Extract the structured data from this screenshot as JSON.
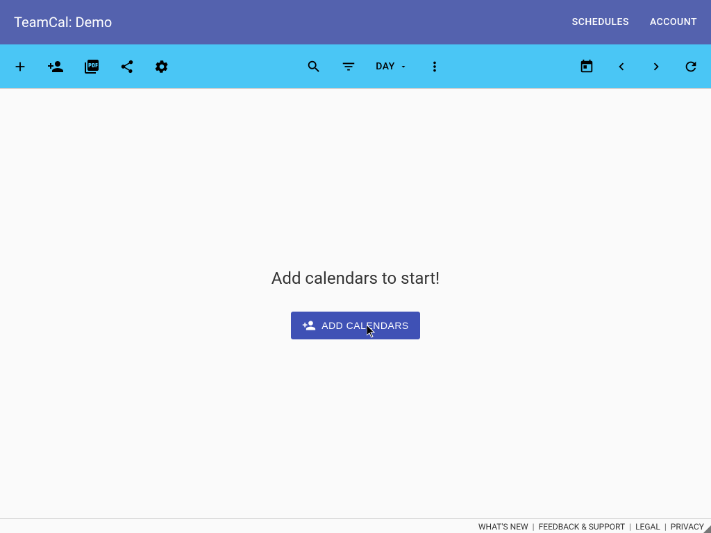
{
  "header": {
    "title": "TeamCal: Demo",
    "nav": {
      "schedules": "SCHEDULES",
      "account": "ACCOUNT"
    }
  },
  "toolbar": {
    "view_label": "DAY"
  },
  "main": {
    "empty_title": "Add calendars to start!",
    "add_calendars_label": "ADD CALENDARS"
  },
  "footer": {
    "whats_new": "WHAT'S NEW",
    "feedback": "FEEDBACK & SUPPORT",
    "legal": "LEGAL",
    "privacy": "PRIVACY"
  }
}
